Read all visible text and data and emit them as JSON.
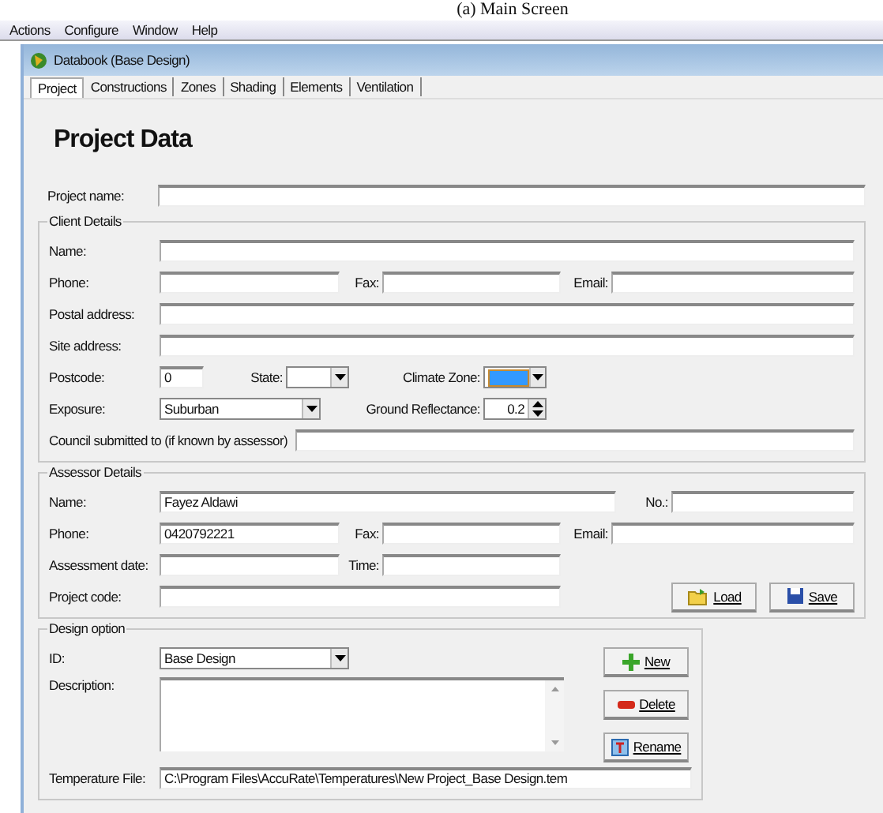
{
  "caption": "(a) Main Screen",
  "menu": [
    "Actions",
    "Configure",
    "Window",
    "Help"
  ],
  "window": {
    "title": "Databook  (Base Design)"
  },
  "tabs": [
    {
      "label": "Project",
      "selected": true
    },
    {
      "label": "Constructions",
      "selected": false
    },
    {
      "label": "Zones",
      "selected": false
    },
    {
      "label": "Shading",
      "selected": false
    },
    {
      "label": "Elements",
      "selected": false
    },
    {
      "label": "Ventilation",
      "selected": false
    }
  ],
  "heading": "Project Data",
  "project_name": {
    "label": "Project name:"
  },
  "client": {
    "title": "Client Details",
    "name": {
      "label": "Name:"
    },
    "phone": {
      "label": "Phone:"
    },
    "fax": {
      "label": "Fax:"
    },
    "email": {
      "label": "Email:"
    },
    "postal": {
      "label": "Postal address:"
    },
    "site": {
      "label": "Site address:"
    },
    "postcode": {
      "label": "Postcode:",
      "value": "0"
    },
    "state": {
      "label": "State:"
    },
    "climate_zone": {
      "label": "Climate Zone:",
      "color": "#3399ff"
    },
    "exposure": {
      "label": "Exposure:",
      "value": "Suburban"
    },
    "ground_reflectance": {
      "label": "Ground Reflectance:",
      "value": "0.2"
    },
    "council": {
      "label": "Council submitted to (if known by assessor)"
    }
  },
  "assessor": {
    "title": "Assessor Details",
    "name": {
      "label": "Name:",
      "value": "Fayez Aldawi"
    },
    "no": {
      "label": "No.:"
    },
    "phone": {
      "label": "Phone:",
      "value": "0420792221"
    },
    "fax": {
      "label": "Fax:"
    },
    "email": {
      "label": "Email:"
    },
    "date": {
      "label": "Assessment date:"
    },
    "time": {
      "label": "Time:"
    },
    "code": {
      "label": "Project code:"
    },
    "buttons": [
      {
        "label": "Load",
        "kind": "load"
      },
      {
        "label": "Save",
        "kind": "save"
      }
    ]
  },
  "design": {
    "title": "Design option",
    "id": {
      "label": "ID:",
      "value": "Base Design"
    },
    "description": {
      "label": "Description:"
    },
    "buttons": [
      {
        "label": "New",
        "kind": "new"
      },
      {
        "label": "Delete",
        "kind": "delete"
      },
      {
        "label": "Rename",
        "kind": "rename"
      }
    ],
    "temperature_file": {
      "label": "Temperature File:",
      "value": "C:\\Program Files\\AccuRate\\Temperatures\\New Project_Base Design.tem"
    }
  }
}
